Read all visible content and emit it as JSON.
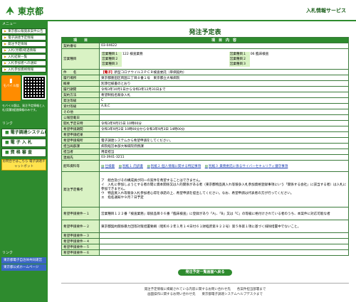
{
  "header": {
    "logo_text": "東京都",
    "service_title": "入札情報サービス"
  },
  "sidebar": {
    "menu_label": "メニュー",
    "items": [
      "東京都公報発表案件公告",
      "電子調達予定情報",
      "発注予定情報",
      "入札(見積)経過情報",
      "入札結果一覧",
      "入札参加者への通知",
      "入札参加資格情報"
    ],
    "mobile_badge": "モバイル版",
    "mobile_note": "モバイル版は、発注予定情報と入札(見積)経過情報のみです。",
    "links_label": "リンク",
    "big_items": [
      "電子調達システム(TOP)",
      "電 子 入 札",
      "資 格 審 査"
    ],
    "banner_text": "お問合せはこちら 電子調達チャットボット",
    "bottom_label": "リンク",
    "blue_links": [
      "東京都電子自治体共同運営",
      "東京都公式ホームページ"
    ]
  },
  "main": {
    "title": "発注予定表",
    "col_item": "項　　目",
    "col_content": "項　目　内　容",
    "rows": {
      "contract_no": {
        "label": "契約番号",
        "value": "03-04622"
      },
      "category": {
        "label": "営業種目",
        "grid": [
          [
            "営業種目１",
            "122 検査業務",
            "営業種目１",
            "06 臨床検査"
          ],
          [
            "営業種目２",
            "",
            "営業種目２",
            ""
          ],
          [
            "営業種目３",
            "",
            "営業種目３",
            ""
          ]
        ]
      },
      "subject": {
        "label": "件　　名",
        "tag": "【電子】",
        "value": "新型コロナウイルスＰＣＲ検査委託（単価契約）"
      },
      "location": {
        "label": "履行場所",
        "value": "東京都墨田区両国三丁目８番１号　東京都立大塚病院"
      },
      "overview": {
        "label": "概要",
        "value": "別添仕様書のとおり"
      },
      "period": {
        "label": "履行期間",
        "value": "令和3年10月1日から令和3年12月31日まで"
      },
      "method": {
        "label": "契約方法",
        "value": "希望制指名競争入札"
      },
      "order_rank": {
        "label": "発注等級",
        "value": "C"
      },
      "accept_rank": {
        "label": "受付等級",
        "value": "A,B,C"
      },
      "other": {
        "label": "その他",
        "value": ""
      },
      "publish_date": {
        "label": "公報登載日",
        "value": ""
      },
      "open_date": {
        "label": "開札予定日時",
        "value": "令和3年9月15日 10時00分"
      },
      "apply_deadline": {
        "label": "希望申請期間",
        "value": "令和3年9月2日 10時00分から令和3年9月3日 14時00分"
      },
      "apply_result": {
        "label": "希望申請結果",
        "value": ""
      },
      "apply_method": {
        "label": "希望申請場所",
        "value": "電子調達システムから希望申請をしてください。"
      },
      "department": {
        "label": "担当局部課",
        "value": "病院経営本部大塚病院庶務課"
      },
      "person": {
        "label": "担当者",
        "value": "用度担当"
      },
      "contact": {
        "label": "連絡先",
        "value": "03-3941-3211"
      },
      "documents": {
        "label": "配布資料等",
        "links": [
          "仕様書",
          "別紙１ 内訳書",
          "別紙２ 個人情報に関する特記事項",
          "別紙３ 業務委託に係るサイバーセキュリティ遵守事項"
        ]
      },
      "conditions": {
        "label": "発注予定備考",
        "value": "ア　組合及びその構成員が同一の案件を希望することはできません。\nイ　入札に参加しようとする者の間に資本関係又は人的関係がある者（東京都物品買入れ等競争入札参加資格登録事項にいう「関係する会社」に該当する者）は入札に参加できません。\nウ　物品買入れ等競争入札参加者心得を承諾の上、希望申請を提出してください。なお、希望申請は代表者の方が行ってください。\nエ　指名通知や９月７日予定"
      },
      "requirement1": {
        "label": "希望申請要件－１",
        "value": "営業種目１２２番「検査業務」取扱品目０６番「臨床検査」に登録があり「A」、「B」又は「C」の等級に格付けされている者のうち、本案件に対応可能な者"
      },
      "requirement2": {
        "label": "希望申請要件－２",
        "value": "東京都契約関係暴力団等対策措置要綱（昭和６２年１月１４日付６１財経庶第９２２号）第５条第１項に基づく排除措置中でないこと。"
      },
      "requirement3": {
        "label": "希望申請要件－３",
        "value": ""
      },
      "requirement4": {
        "label": "希望申請要件－４",
        "value": ""
      },
      "requirement5": {
        "label": "希望申請要件－５",
        "value": ""
      },
      "requirement6": {
        "label": "希望申請要件－６",
        "value": ""
      }
    },
    "back_button": "発注予定一覧画面へ戻る"
  },
  "footer": {
    "line1": "発注予定情報に掲載されている内容に関するお問い合わせ先　　各案件担当部署まで",
    "line2": "画面操作に関するお問い合わせ先　　東京都電子調達システムヘルプデスクまで"
  }
}
